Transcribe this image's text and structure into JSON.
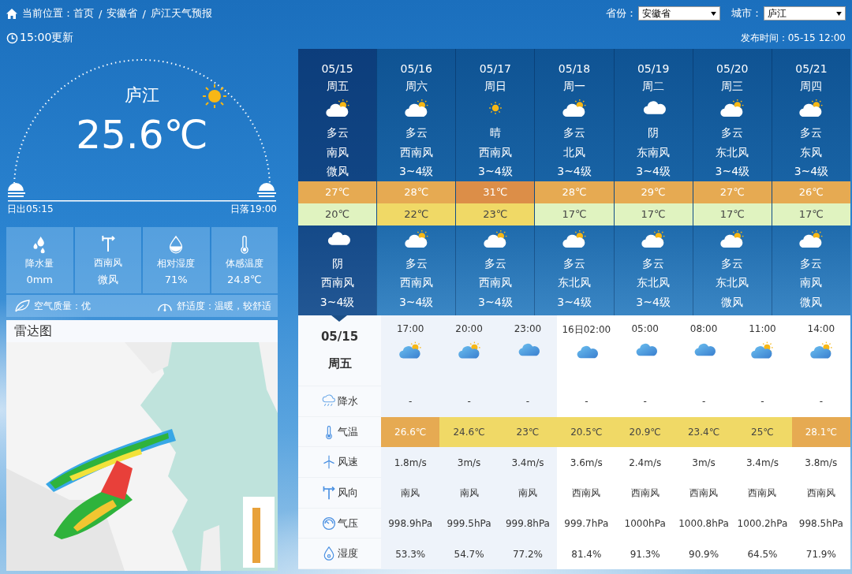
{
  "breadcrumb": {
    "items": [
      "当前位置：首页",
      "安徽省",
      "庐江天气预报"
    ],
    "separator": "/"
  },
  "selectors": [
    {
      "label": "省份：",
      "value": "安徽省"
    },
    {
      "label": "城市：",
      "value": "庐江"
    }
  ],
  "update_time": "15:00更新",
  "publish_time": "发布时间：05-15 12:00",
  "current": {
    "city": "庐江",
    "temperature": "25.6℃",
    "sunrise": "日出05:15",
    "sunset": "日落19:00"
  },
  "stats": [
    {
      "kind": "rain",
      "label": "降水量",
      "value": "0mm"
    },
    {
      "kind": "wind",
      "label": "西南风",
      "value": "微风"
    },
    {
      "kind": "humidity",
      "label": "相对湿度",
      "value": "71%"
    },
    {
      "kind": "feels",
      "label": "体感温度",
      "value": "24.8℃"
    }
  ],
  "air_quality": "空气质量：优",
  "comfort": "舒适度：温暖，较舒适",
  "radar": {
    "title": "雷达图",
    "kind": "picture"
  },
  "days": [
    {
      "date": "05/15",
      "weekday": "周五",
      "selected": true,
      "day": {
        "kind": "partly_cloudy",
        "weather": "多云",
        "wind_dir": "南风",
        "wind_level": "微风"
      },
      "high": {
        "text": "27℃",
        "color": "#e6aa52"
      },
      "low": {
        "text": "20℃",
        "color": "#e0f3c0"
      },
      "night": {
        "kind": "overcast",
        "weather": "阴",
        "wind_dir": "西南风",
        "wind_level": "3~4级"
      }
    },
    {
      "date": "05/16",
      "weekday": "周六",
      "selected": false,
      "day": {
        "kind": "partly_cloudy",
        "weather": "多云",
        "wind_dir": "西南风",
        "wind_level": "3~4级"
      },
      "high": {
        "text": "28℃",
        "color": "#e6aa52"
      },
      "low": {
        "text": "22℃",
        "color": "#f0d966"
      },
      "night": {
        "kind": "partly_cloudy",
        "weather": "多云",
        "wind_dir": "西南风",
        "wind_level": "3~4级"
      }
    },
    {
      "date": "05/17",
      "weekday": "周日",
      "selected": false,
      "day": {
        "kind": "sunny",
        "weather": "晴",
        "wind_dir": "西南风",
        "wind_level": "3~4级"
      },
      "high": {
        "text": "31℃",
        "color": "#dc8e48"
      },
      "low": {
        "text": "23℃",
        "color": "#f0d966"
      },
      "night": {
        "kind": "partly_cloudy",
        "weather": "多云",
        "wind_dir": "西南风",
        "wind_level": "3~4级"
      }
    },
    {
      "date": "05/18",
      "weekday": "周一",
      "selected": false,
      "day": {
        "kind": "partly_cloudy",
        "weather": "多云",
        "wind_dir": "北风",
        "wind_level": "3~4级"
      },
      "high": {
        "text": "28℃",
        "color": "#e6aa52"
      },
      "low": {
        "text": "17℃",
        "color": "#e0f3c0"
      },
      "night": {
        "kind": "partly_cloudy",
        "weather": "多云",
        "wind_dir": "东北风",
        "wind_level": "3~4级"
      }
    },
    {
      "date": "05/19",
      "weekday": "周二",
      "selected": false,
      "day": {
        "kind": "overcast",
        "weather": "阴",
        "wind_dir": "东南风",
        "wind_level": "3~4级"
      },
      "high": {
        "text": "29℃",
        "color": "#e6aa52"
      },
      "low": {
        "text": "17℃",
        "color": "#e0f3c0"
      },
      "night": {
        "kind": "partly_cloudy",
        "weather": "多云",
        "wind_dir": "东北风",
        "wind_level": "3~4级"
      }
    },
    {
      "date": "05/20",
      "weekday": "周三",
      "selected": false,
      "day": {
        "kind": "partly_cloudy",
        "weather": "多云",
        "wind_dir": "东北风",
        "wind_level": "3~4级"
      },
      "high": {
        "text": "27℃",
        "color": "#e6aa52"
      },
      "low": {
        "text": "17℃",
        "color": "#e0f3c0"
      },
      "night": {
        "kind": "partly_cloudy",
        "weather": "多云",
        "wind_dir": "东北风",
        "wind_level": "微风"
      }
    },
    {
      "date": "05/21",
      "weekday": "周四",
      "selected": false,
      "day": {
        "kind": "partly_cloudy",
        "weather": "多云",
        "wind_dir": "东风",
        "wind_level": "3~4级"
      },
      "high": {
        "text": "26℃",
        "color": "#e6aa52"
      },
      "low": {
        "text": "17℃",
        "color": "#e0f3c0"
      },
      "night": {
        "kind": "partly_cloudy",
        "weather": "多云",
        "wind_dir": "南风",
        "wind_level": "微风"
      }
    }
  ],
  "hourly": {
    "date": "05/15",
    "weekday": "周五",
    "hours": [
      {
        "time": "17:00",
        "kind": "partly_cloudy",
        "shaded": true
      },
      {
        "time": "20:00",
        "kind": "partly_cloudy",
        "shaded": true
      },
      {
        "time": "23:00",
        "kind": "overcast",
        "shaded": true
      },
      {
        "time": "16日02:00",
        "kind": "overcast",
        "shaded": false
      },
      {
        "time": "05:00",
        "kind": "overcast",
        "shaded": false
      },
      {
        "time": "08:00",
        "kind": "overcast",
        "shaded": false
      },
      {
        "time": "11:00",
        "kind": "partly_cloudy",
        "shaded": false
      },
      {
        "time": "14:00",
        "kind": "partly_cloudy",
        "shaded": false
      }
    ],
    "rows": [
      {
        "kind": "precipitation",
        "label": "降水",
        "cells": [
          {
            "value": "-"
          },
          {
            "value": "-"
          },
          {
            "value": "-"
          },
          {
            "value": "-"
          },
          {
            "value": "-"
          },
          {
            "value": "-"
          },
          {
            "value": "-"
          },
          {
            "value": "-"
          }
        ]
      },
      {
        "kind": "temperature",
        "label": "气温",
        "cells": [
          {
            "value": "26.6℃",
            "color": "#e6aa52"
          },
          {
            "value": "24.6℃",
            "color": "#f0d966"
          },
          {
            "value": "23℃",
            "color": "#f0d966"
          },
          {
            "value": "20.5℃",
            "color": "#f0d966"
          },
          {
            "value": "20.9℃",
            "color": "#f0d966"
          },
          {
            "value": "23.4℃",
            "color": "#f0d966"
          },
          {
            "value": "25℃",
            "color": "#f0d966"
          },
          {
            "value": "28.1℃",
            "color": "#e6aa52"
          }
        ]
      },
      {
        "kind": "wind_speed",
        "label": "风速",
        "cells": [
          {
            "value": "1.8m/s"
          },
          {
            "value": "3m/s"
          },
          {
            "value": "3.4m/s"
          },
          {
            "value": "3.6m/s"
          },
          {
            "value": "2.4m/s"
          },
          {
            "value": "3m/s"
          },
          {
            "value": "3.4m/s"
          },
          {
            "value": "3.8m/s"
          }
        ]
      },
      {
        "kind": "wind_direction",
        "label": "风向",
        "cells": [
          {
            "value": "南风"
          },
          {
            "value": "南风"
          },
          {
            "value": "南风"
          },
          {
            "value": "西南风"
          },
          {
            "value": "西南风"
          },
          {
            "value": "西南风"
          },
          {
            "value": "西南风"
          },
          {
            "value": "西南风"
          }
        ]
      },
      {
        "kind": "pressure",
        "label": "气压",
        "cells": [
          {
            "value": "998.9hPa"
          },
          {
            "value": "999.5hPa"
          },
          {
            "value": "999.8hPa"
          },
          {
            "value": "999.7hPa"
          },
          {
            "value": "1000hPa"
          },
          {
            "value": "1000.8hPa"
          },
          {
            "value": "1000.2hPa"
          },
          {
            "value": "998.5hPa"
          }
        ]
      },
      {
        "kind": "humidity",
        "label": "湿度",
        "cells": [
          {
            "value": "53.3%"
          },
          {
            "value": "54.7%"
          },
          {
            "value": "77.2%"
          },
          {
            "value": "81.4%"
          },
          {
            "value": "91.3%"
          },
          {
            "value": "90.9%"
          },
          {
            "value": "64.5%"
          },
          {
            "value": "71.9%"
          }
        ]
      }
    ]
  }
}
